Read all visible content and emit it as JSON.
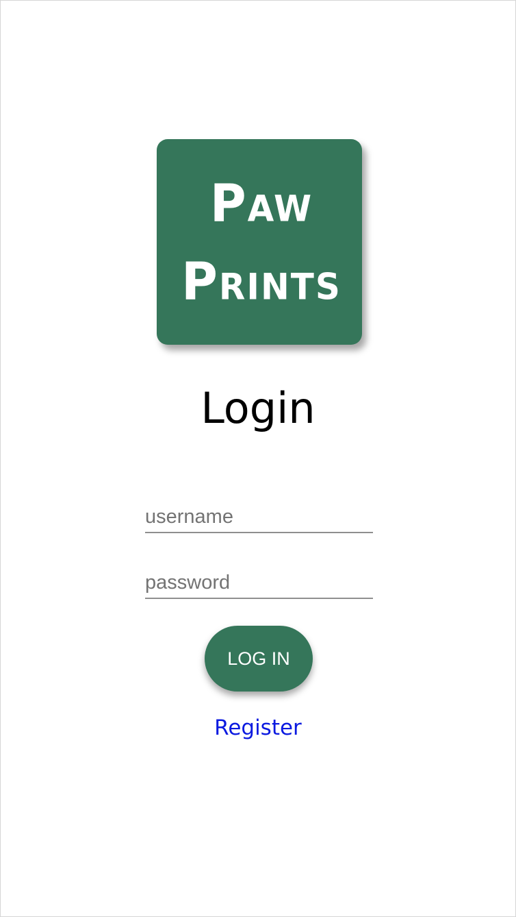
{
  "logo": {
    "line1": "Paw",
    "line2": "Prints",
    "background": "#35765a"
  },
  "page": {
    "title": "Login"
  },
  "form": {
    "username_placeholder": "username",
    "password_placeholder": "password",
    "login_label": "LOG IN"
  },
  "links": {
    "register": "Register",
    "register_color": "#0b1ae0"
  }
}
